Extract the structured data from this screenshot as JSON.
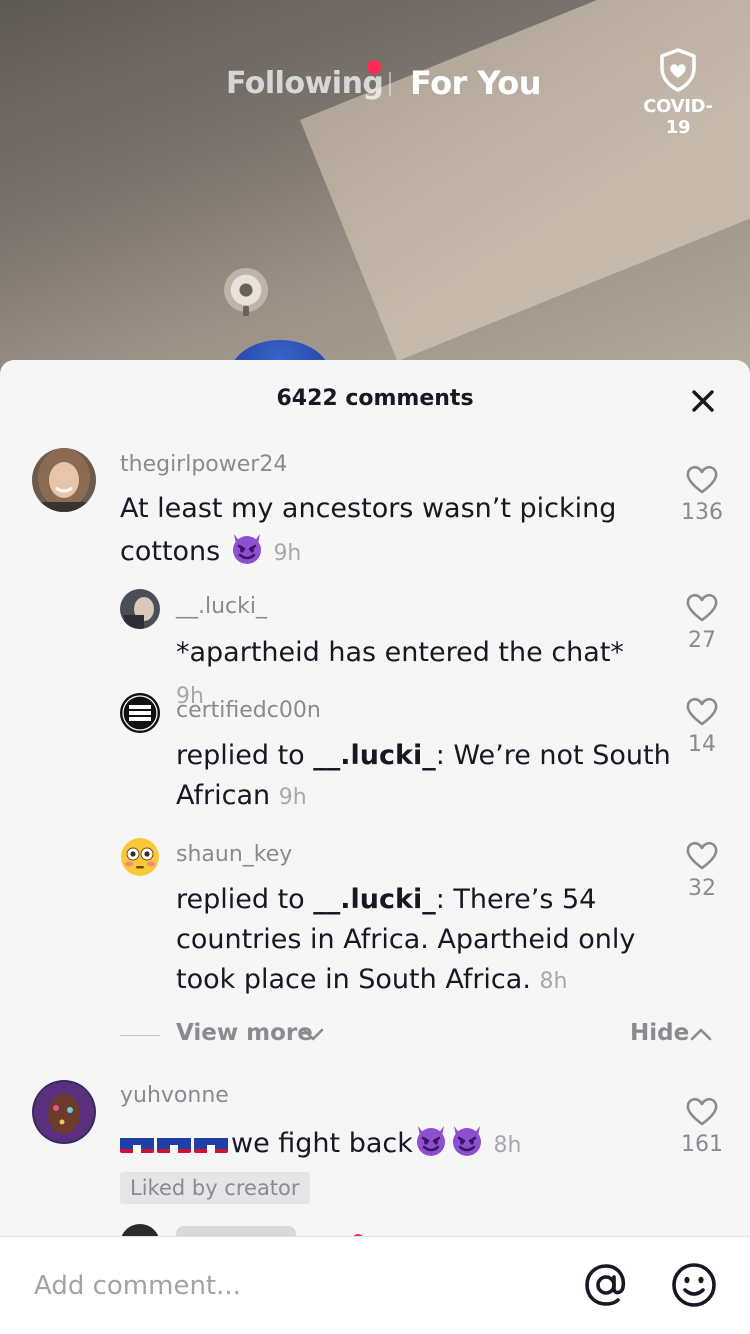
{
  "top_nav": {
    "following_label": "Following",
    "for_you_label": "For You",
    "covid_label": "COVID-19"
  },
  "comments_sheet": {
    "title": "6422 comments",
    "comments": [
      {
        "username": "thegirlpower24",
        "text_line1": "At least my ancestors wasn’t picking",
        "text_line2": "cottons",
        "time": "9h",
        "likes": "136"
      },
      {
        "username": "__.lucki_",
        "text": "*apartheid has entered the chat*",
        "time": "9h",
        "likes": "27"
      },
      {
        "username": "certifiedc00n",
        "replied_prefix": "replied to ",
        "replied_to": "__.lucki_",
        "text_line1": ": We’re not South",
        "text_line2": "African",
        "time": "9h",
        "likes": "14",
        "avatar_text": "BIDEN HARRIS 2020"
      },
      {
        "username": "shaun_key",
        "replied_prefix": "replied to ",
        "replied_to": "__.lucki_",
        "text_line1": ": There’s 54",
        "text_line2": "countries in Africa. Apartheid only",
        "text_line3": "took place in South Africa.",
        "time": "8h",
        "likes": "32"
      },
      {
        "username": "yuhvonne",
        "text": "we fight back",
        "time": "8h",
        "likes": "161",
        "badge": "Liked by creator"
      }
    ],
    "view_more_label": "View more",
    "hide_label": "Hide"
  },
  "input_bar": {
    "placeholder": "Add comment..."
  },
  "colors": {
    "accent": "#fe2c55",
    "sheet_bg": "#f6f6f6",
    "text_primary": "#161823",
    "text_secondary": "#8a8b91"
  }
}
